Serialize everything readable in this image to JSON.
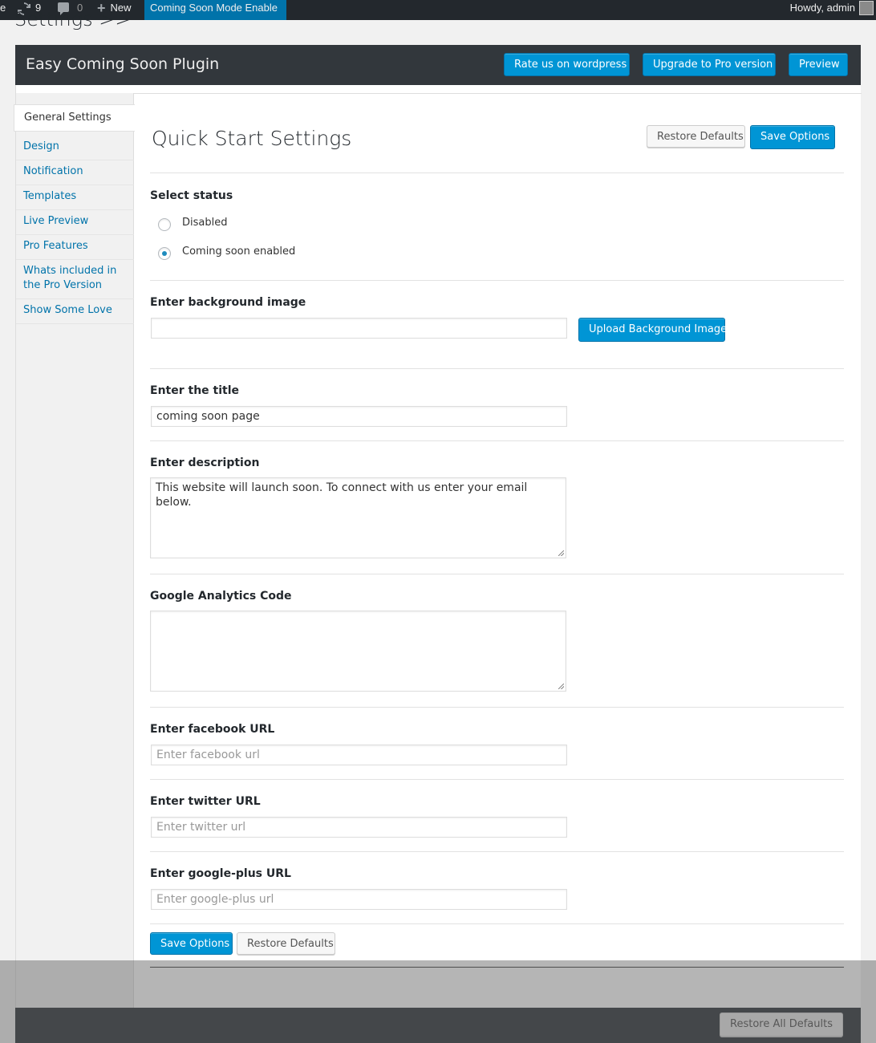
{
  "admin_bar": {
    "cut_label": "e",
    "updates_count": "9",
    "comments_count": "0",
    "new_label": "New",
    "coming_soon_label": "Coming Soon Mode Enable",
    "howdy": "Howdy, admin"
  },
  "page": {
    "heading": "Settings >>"
  },
  "plugin_header": {
    "title": "Easy Coming Soon Plugin",
    "rate_label": "Rate us on wordpress",
    "upgrade_label": "Upgrade to Pro version",
    "preview_label": "Preview"
  },
  "sidebar": {
    "items": [
      {
        "label": "General Settings"
      },
      {
        "label": "Design"
      },
      {
        "label": "Notification"
      },
      {
        "label": "Templates"
      },
      {
        "label": "Live Preview"
      },
      {
        "label": "Pro Features"
      },
      {
        "label": "Whats included in the Pro Version"
      },
      {
        "label": "Show Some Love"
      }
    ]
  },
  "main": {
    "title": "Quick Start Settings",
    "restore_label": "Restore Defaults",
    "save_label": "Save Options",
    "status": {
      "label": "Select status",
      "options": [
        {
          "label": "Disabled",
          "checked": false
        },
        {
          "label": "Coming soon enabled",
          "checked": true
        }
      ]
    },
    "background": {
      "label": "Enter background image",
      "value": "",
      "upload_label": "Upload Background Image"
    },
    "title_field": {
      "label": "Enter the title",
      "value": "coming soon page"
    },
    "description": {
      "label": "Enter description",
      "value": "This website will launch soon. To connect with us enter your email below."
    },
    "analytics": {
      "label": "Google Analytics Code",
      "value": ""
    },
    "facebook": {
      "label": "Enter facebook URL",
      "placeholder": "Enter facebook url"
    },
    "twitter": {
      "label": "Enter twitter URL",
      "placeholder": "Enter twitter url"
    },
    "googleplus": {
      "label": "Enter google-plus URL",
      "placeholder": "Enter google-plus url"
    },
    "bottom_save_label": "Save Options",
    "bottom_restore_label": "Restore Defaults"
  },
  "footer": {
    "restore_all_label": "Restore All Defaults"
  },
  "colors": {
    "admin_bar": "#23282d",
    "accent": "#0095d5",
    "header_bg": "#32373c",
    "link": "#0073aa"
  }
}
